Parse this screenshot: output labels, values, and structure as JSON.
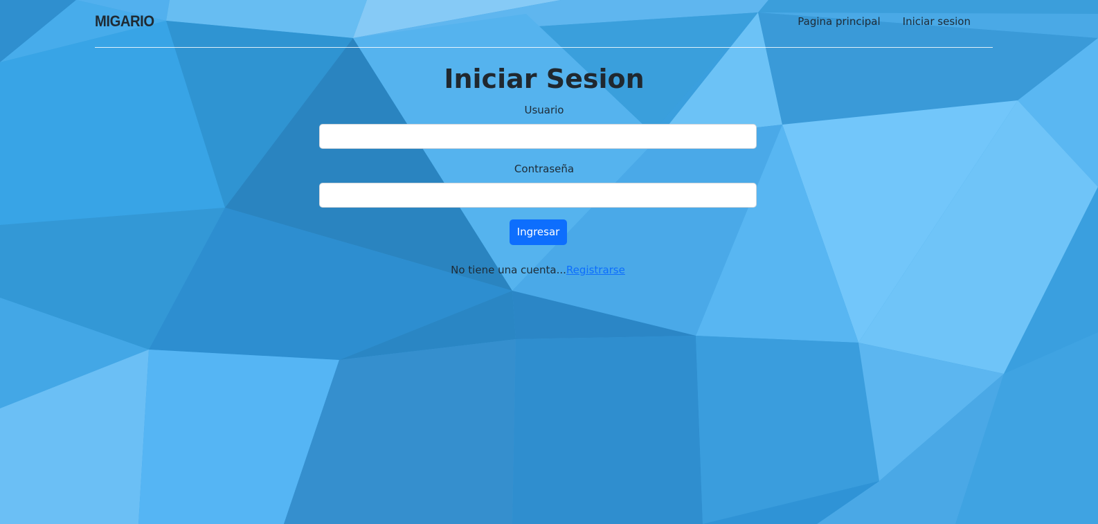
{
  "brand": "MIGARIO",
  "nav": {
    "items": [
      {
        "label": "Pagina principal"
      },
      {
        "label": "Iniciar sesion"
      }
    ]
  },
  "form": {
    "title": "Iniciar Sesion",
    "username_label": "Usuario",
    "username_value": "",
    "password_label": "Contraseña",
    "password_value": "",
    "submit_label": "Ingresar"
  },
  "footer_prompt": {
    "text": "No tiene una cuenta...",
    "link_label": "Registrarse"
  },
  "colors": {
    "accent": "#0d6efd",
    "background": "#3aa3e0"
  }
}
